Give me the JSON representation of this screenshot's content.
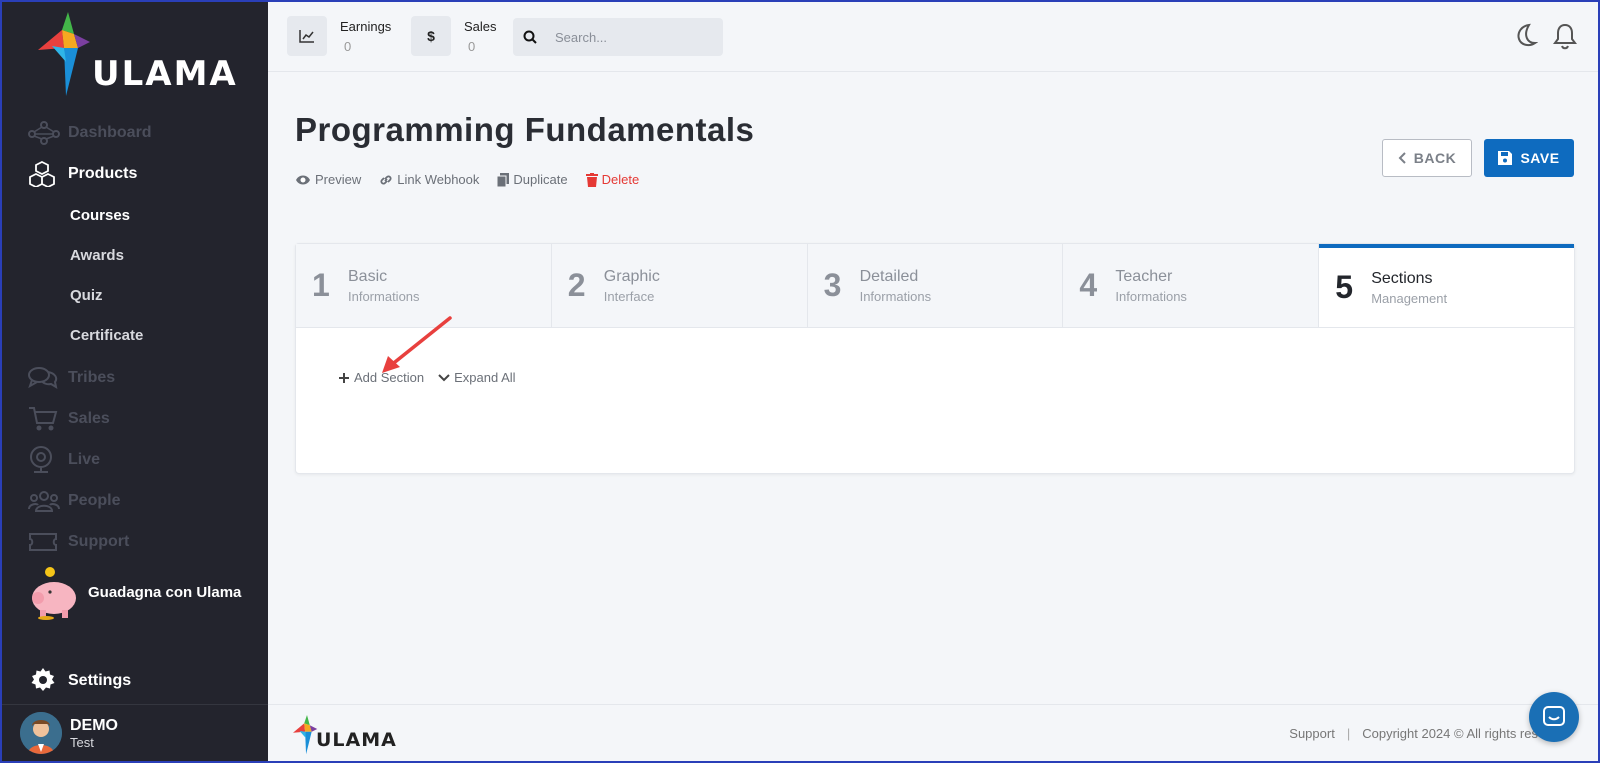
{
  "brand": {
    "name": "ULAMA"
  },
  "sidebar": {
    "items": [
      {
        "label": "Dashboard",
        "icon": "dashboard-icon"
      },
      {
        "label": "Products",
        "icon": "cubes-icon"
      },
      {
        "label": "Tribes",
        "icon": "chat-icon"
      },
      {
        "label": "Sales",
        "icon": "cart-icon"
      },
      {
        "label": "Live",
        "icon": "webcam-icon"
      },
      {
        "label": "People",
        "icon": "people-icon"
      },
      {
        "label": "Support",
        "icon": "ticket-icon"
      }
    ],
    "sub_items": [
      {
        "label": "Courses"
      },
      {
        "label": "Awards"
      },
      {
        "label": "Quiz"
      },
      {
        "label": "Certificate"
      }
    ],
    "promo": {
      "label": "Guadagna con Ulama"
    },
    "settings": {
      "label": "Settings"
    },
    "user": {
      "name": "DEMO",
      "subtitle": "Test"
    }
  },
  "topbar": {
    "earnings": {
      "label": "Earnings",
      "value": "0"
    },
    "sales": {
      "label": "Sales",
      "value": "0",
      "icon_text": "$"
    },
    "search": {
      "placeholder": "Search..."
    }
  },
  "page": {
    "title": "Programming Fundamentals",
    "actions": {
      "preview": "Preview",
      "webhook": "Link Webhook",
      "duplicate": "Duplicate",
      "delete": "Delete"
    },
    "back_label": "BACK",
    "save_label": "SAVE"
  },
  "steps": [
    {
      "num": "1",
      "title": "Basic",
      "subtitle": "Informations"
    },
    {
      "num": "2",
      "title": "Graphic",
      "subtitle": "Interface"
    },
    {
      "num": "3",
      "title": "Detailed",
      "subtitle": "Informations"
    },
    {
      "num": "4",
      "title": "Teacher",
      "subtitle": "Informations"
    },
    {
      "num": "5",
      "title": "Sections",
      "subtitle": "Management"
    }
  ],
  "sections": {
    "add_label": "Add Section",
    "expand_label": "Expand All"
  },
  "footer": {
    "support": "Support",
    "separator": "|",
    "copyright": "Copyright 2024 © All rights res"
  },
  "colors": {
    "primary": "#0e6bbf",
    "sidebar_bg": "#23242d",
    "danger": "#e53935",
    "annotation_arrow": "#e8403e"
  }
}
